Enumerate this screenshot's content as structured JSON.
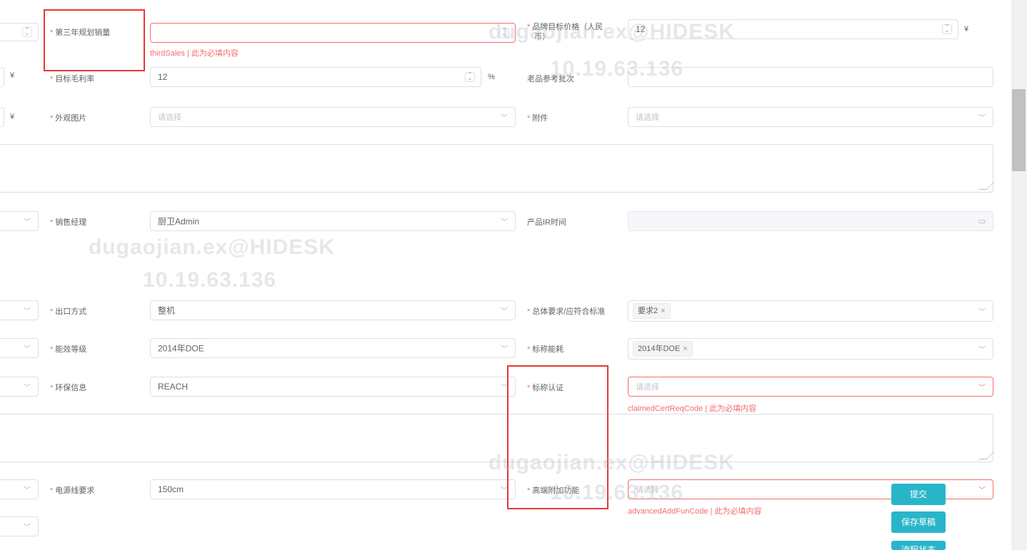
{
  "fields": {
    "third_sales": {
      "label": "第三年规划销量",
      "error": "thirdSales | 此为必填内容"
    },
    "brand_price": {
      "label_line1": "品牌目标价格（人民",
      "label_line2": "币）",
      "value": "12",
      "unit": "¥"
    },
    "target_margin": {
      "label": "目标毛利率",
      "value": "12",
      "unit": "%"
    },
    "old_ref_batch": {
      "label": "老品参考批次"
    },
    "appearance_image": {
      "label": "外观图片",
      "placeholder": "请选择"
    },
    "attachment": {
      "label": "附件",
      "placeholder": "请选择"
    },
    "sales_manager": {
      "label": "销售经理",
      "value": "厨卫Admin"
    },
    "product_ir_time": {
      "label": "产品IR时间"
    },
    "export_mode": {
      "label": "出口方式",
      "value": "整机"
    },
    "overall_standard": {
      "label": "总体要求/应符合标准",
      "tag": "要求2"
    },
    "energy_grade": {
      "label": "能效等级",
      "value": "2014年DOE"
    },
    "claimed_energy": {
      "label": "标称能耗",
      "tag": "2014年DOE"
    },
    "env_info": {
      "label": "环保信息",
      "value": "REACH"
    },
    "claimed_cert": {
      "label": "标称认证",
      "placeholder": "请选择",
      "error": "claimedCertReqCode | 此为必填内容"
    },
    "power_cord": {
      "label": "电源线要求",
      "value": "150cm"
    },
    "advanced_func": {
      "label": "高端附加功能",
      "placeholder": "请选择",
      "error": "advancedAddFunCode | 此为必填内容"
    }
  },
  "left_units": {
    "row2": "¥",
    "row3": "¥"
  },
  "buttons": {
    "submit": "提交",
    "save_draft": "保存草稿",
    "third": "流程状态"
  },
  "watermarks": {
    "user": "dugaojian.ex@HIDESK",
    "ip": "10.19.63.136"
  },
  "icons": {
    "spinner": "spinner-icon",
    "chevron": "chevron-down-icon",
    "calendar": "calendar-icon",
    "close": "close-icon",
    "resize": "resize-handle-icon"
  },
  "colors": {
    "error": "#f56c6c",
    "accent": "#29b5c9",
    "highlight_frame": "#e53935"
  }
}
